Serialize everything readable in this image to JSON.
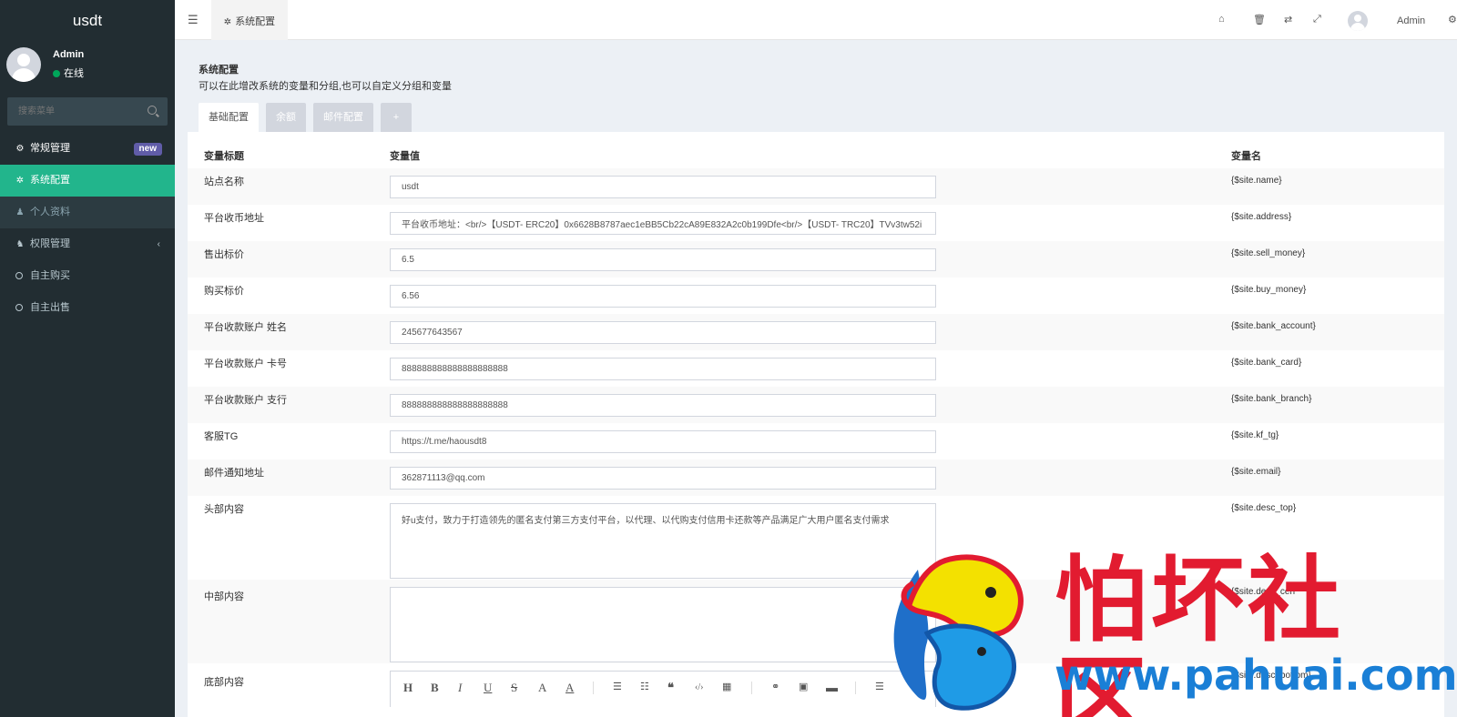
{
  "brand": "usdt",
  "user": {
    "name": "Admin",
    "status": "在线"
  },
  "search": {
    "placeholder": "搜索菜单"
  },
  "menu": {
    "general": "常规管理",
    "general_badge": "new",
    "system_config": "系统配置",
    "profile": "个人资料",
    "auth": "权限管理",
    "buy": "自主购买",
    "sell": "自主出售"
  },
  "topbar": {
    "tab_label": "系统配置",
    "admin": "Admin"
  },
  "page": {
    "title": "系统配置",
    "desc": "可以在此增改系统的变量和分组,也可以自定义分组和变量"
  },
  "tabs": [
    "基础配置",
    "余额",
    "邮件配置",
    "+"
  ],
  "table": {
    "col_title": "变量标题",
    "col_value": "变量值",
    "col_name": "变量名",
    "rows": [
      {
        "label": "站点名称",
        "value": "usdt",
        "var": "{$site.name}"
      },
      {
        "label": "平台收币地址",
        "value": "平台收币地址：<br/>【USDT- ERC20】0x6628B8787aec1eBB5Cb22cA89E832A2c0b199Dfe<br/>【USDT- TRC20】TVv3tw52i",
        "var": "{$site.address}"
      },
      {
        "label": "售出标价",
        "value": "6.5",
        "var": "{$site.sell_money}"
      },
      {
        "label": "购买标价",
        "value": "6.56",
        "var": "{$site.buy_money}"
      },
      {
        "label": "平台收款账户 姓名",
        "value": "245677643567",
        "var": "{$site.bank_account}"
      },
      {
        "label": "平台收款账户 卡号",
        "value": "888888888888888888888",
        "var": "{$site.bank_card}"
      },
      {
        "label": "平台收款账户 支行",
        "value": "888888888888888888888",
        "var": "{$site.bank_branch}"
      },
      {
        "label": "客服TG",
        "value": "https://t.me/haousdt8",
        "var": "{$site.kf_tg}"
      },
      {
        "label": "邮件通知地址",
        "value": "362871113@qq.com",
        "var": "{$site.email}"
      },
      {
        "label": "头部内容",
        "value": "好u支付，致力于打造领先的匿名支付第三方支付平台，以代理、以代购支付信用卡还款等产品满足广大用户匿名支付需求",
        "var": "{$site.desc_top}"
      },
      {
        "label": "中部内容",
        "value": "",
        "var": "{$site.desc_cen"
      },
      {
        "label": "底部内容",
        "value": "",
        "var": "{$site.desc_bottom}"
      }
    ]
  },
  "editor_toolbar": [
    "H",
    "B",
    "I",
    "U",
    "S",
    "A",
    "A"
  ],
  "watermark": {
    "text": "怕坏社区",
    "url": "www.pahuai.com"
  },
  "colors": {
    "sidebar": "#222d32",
    "active": "#22b58c",
    "badge": "#605ca8",
    "watermark_red": "#e21b30",
    "watermark_blue": "#1a7fd6"
  }
}
